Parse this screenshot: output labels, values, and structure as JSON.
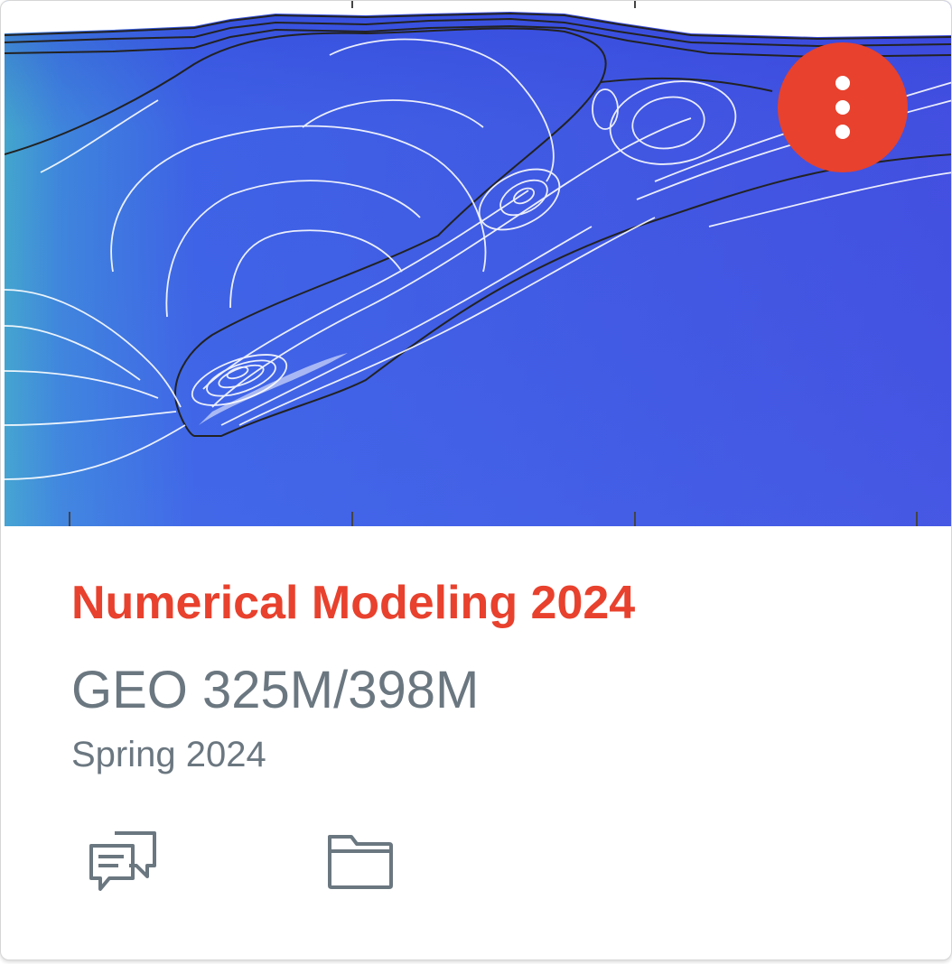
{
  "card": {
    "title": "Numerical Modeling 2024",
    "course_code": "GEO 325M/398M",
    "term": "Spring 2024",
    "hero_image": "subduction-model-contour-plot",
    "options_button_icon": "more-vertical-icon",
    "actions": [
      {
        "name": "discussions",
        "icon": "discussions-icon"
      },
      {
        "name": "files",
        "icon": "folder-icon"
      }
    ]
  },
  "colors": {
    "accent": "#e8412d",
    "text_secondary": "#6b7780",
    "hero_blue": "#3f54e6",
    "hero_teal": "#43b8c8"
  }
}
